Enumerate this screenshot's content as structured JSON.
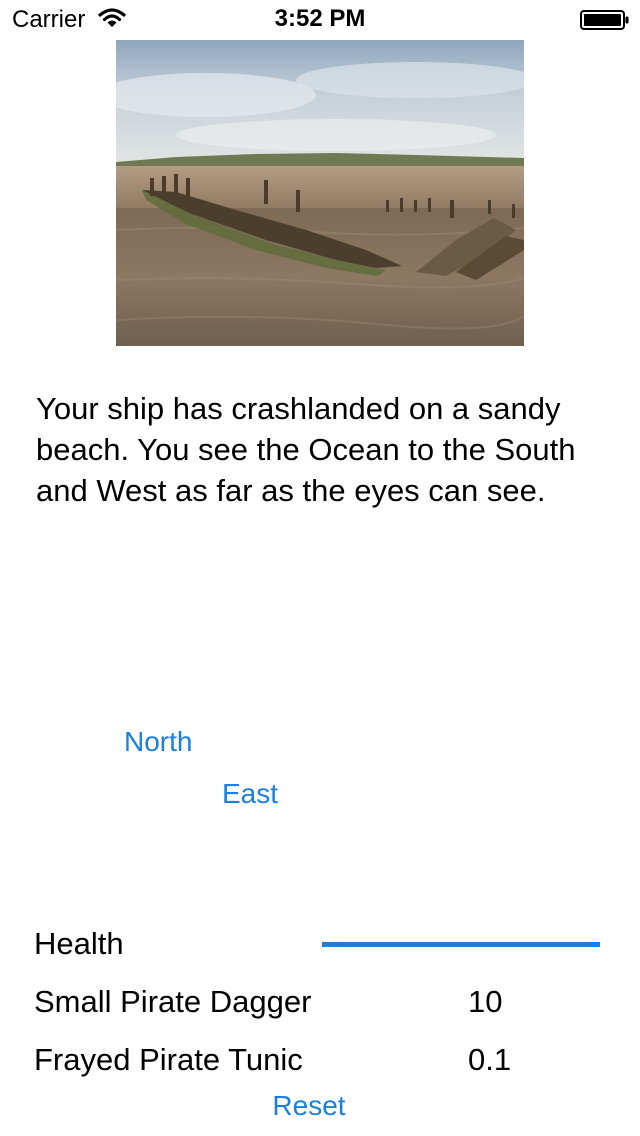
{
  "status_bar": {
    "carrier": "Carrier",
    "time": "3:52 PM",
    "wifi_icon": "wifi-icon",
    "battery_icon": "battery-icon"
  },
  "scene": {
    "image_icon": "shipwreck-photo",
    "description": "Your ship has crashlanded on a sandy beach. You see the Ocean to the South and West as far as the eyes can see."
  },
  "navigation": {
    "north_label": "North",
    "east_label": "East"
  },
  "stats": {
    "health_label": "Health",
    "health_fraction": 1.0,
    "weapon_name": "Small Pirate Dagger",
    "weapon_value": "10",
    "armor_name": "Frayed Pirate Tunic",
    "armor_value": "0.1"
  },
  "reset_label": "Reset",
  "colors": {
    "accent": "#1a7fe0",
    "text": "#000000",
    "background": "#ffffff"
  }
}
